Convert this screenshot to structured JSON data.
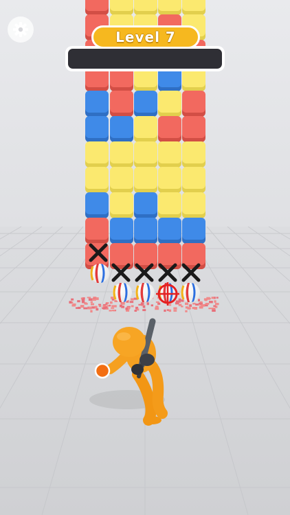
{
  "hud": {
    "level_label": "Level 7",
    "progress": 0,
    "settings_icon": "gear-icon"
  },
  "colors": {
    "red": "#f2695f",
    "blue": "#3f8ae8",
    "yellow": "#fbe96f",
    "orange": "#f59a1e",
    "accent": "#f6b81f"
  },
  "tower": {
    "columns": 5,
    "rows": [
      [
        "red",
        "yellow",
        "yellow",
        "yellow",
        "yellow"
      ],
      [
        "red",
        "yellow",
        "yellow",
        "red",
        "yellow"
      ],
      [
        "red",
        "yellow",
        "yellow",
        "red",
        "red"
      ],
      [
        "red",
        "red",
        "yellow",
        "blue",
        "yellow"
      ],
      [
        "blue",
        "red",
        "blue",
        "yellow",
        "red"
      ],
      [
        "blue",
        "blue",
        "yellow",
        "red",
        "red"
      ],
      [
        "yellow",
        "yellow",
        "yellow",
        "yellow",
        "yellow"
      ],
      [
        "yellow",
        "yellow",
        "yellow",
        "yellow",
        "yellow"
      ],
      [
        "blue",
        "yellow",
        "blue",
        "yellow",
        "yellow"
      ],
      [
        "red",
        "blue",
        "blue",
        "blue",
        "blue"
      ],
      [
        "red",
        "red",
        "red",
        "red",
        "red"
      ]
    ],
    "markers": [
      "x",
      "x",
      "x",
      "x",
      "x",
      "x"
    ],
    "balls": 8,
    "target_icon": "crosshair-icon"
  },
  "player": {
    "character": "orange-batter",
    "bat_icon": "baseball-bat-icon",
    "ball_icon": "orange-ball-icon"
  }
}
